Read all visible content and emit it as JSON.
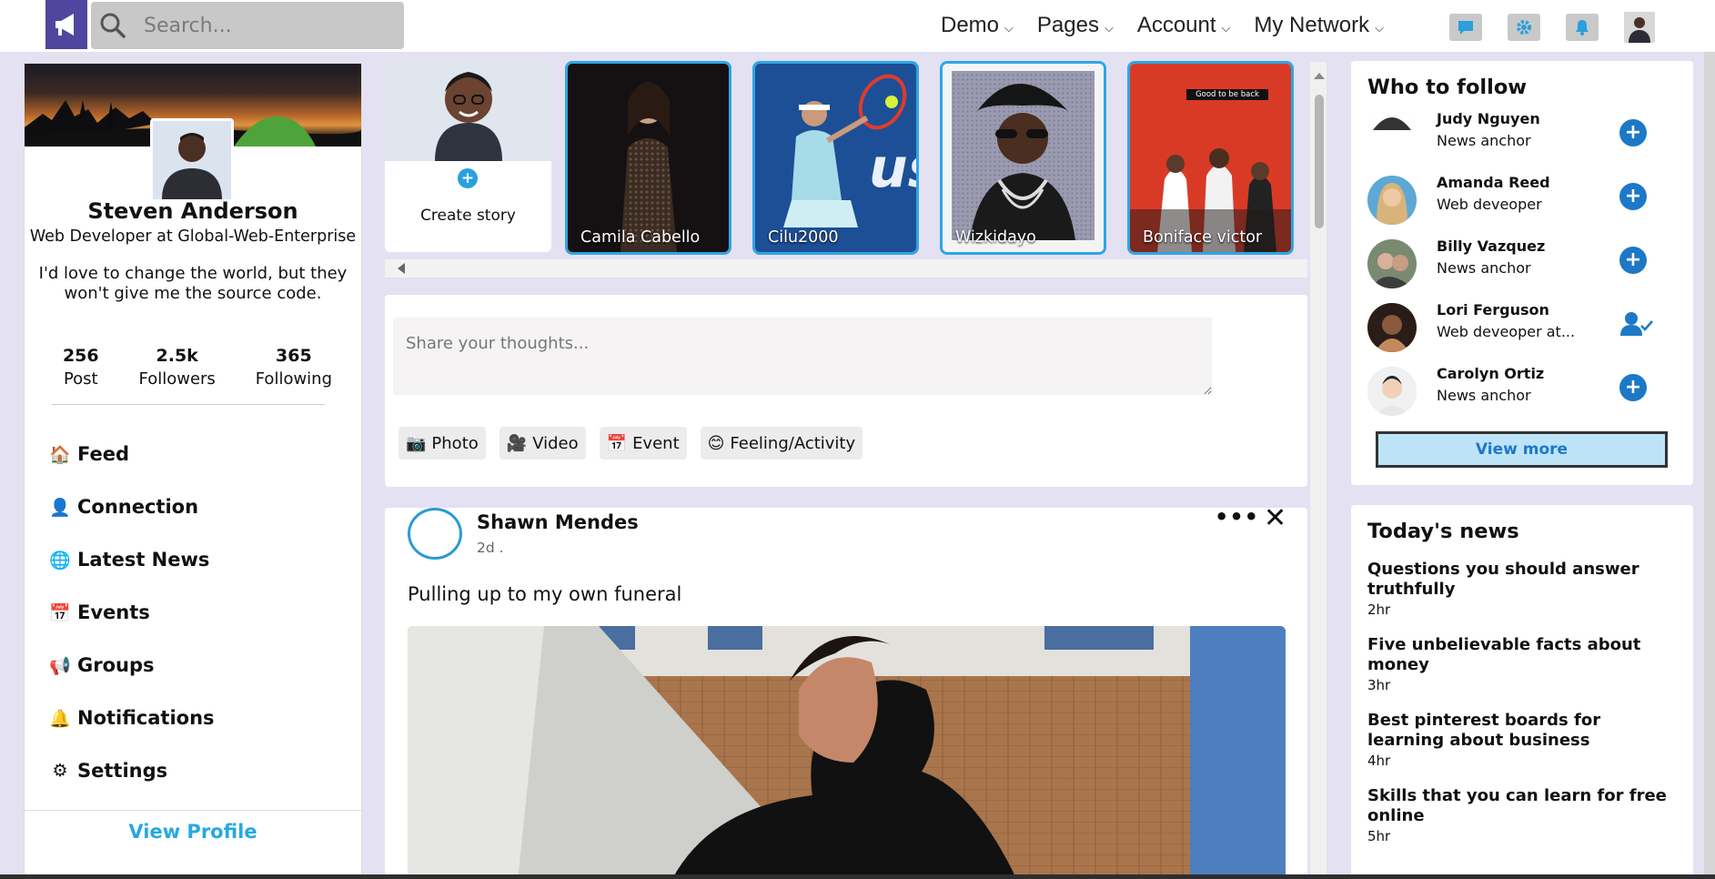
{
  "header": {
    "search_placeholder": "Search...",
    "nav": [
      {
        "label": "Demo"
      },
      {
        "label": "Pages"
      },
      {
        "label": "Account"
      },
      {
        "label": "My Network"
      }
    ],
    "icons": [
      "chat-icon",
      "settings-icon",
      "bell-icon",
      "user-avatar"
    ]
  },
  "profile": {
    "name": "Steven Anderson",
    "title": "Web Developer at Global-Web-Enterprise",
    "bio": "I'd love to change the world, but they won't give me the source code.",
    "stats": [
      {
        "value": "256",
        "label": "Post"
      },
      {
        "value": "2.5k",
        "label": "Followers"
      },
      {
        "value": "365",
        "label": "Following"
      }
    ],
    "menu": [
      {
        "icon": "🏠",
        "label": "Feed"
      },
      {
        "icon": "👤",
        "label": "Connection"
      },
      {
        "icon": "🌐",
        "label": "Latest News"
      },
      {
        "icon": "📅",
        "label": "Events"
      },
      {
        "icon": "📢",
        "label": "Groups"
      },
      {
        "icon": "🔔",
        "label": "Notifications"
      },
      {
        "icon": "⚙",
        "label": "Settings"
      }
    ],
    "view_profile": "View Profile"
  },
  "stories": {
    "create_label": "Create story",
    "items": [
      {
        "name": "Camila Cabello"
      },
      {
        "name": "Cilu2000"
      },
      {
        "name": "Wizkidayo"
      },
      {
        "name": "Boniface victor",
        "overlay": "Good to be back"
      }
    ]
  },
  "composer": {
    "placeholder": "Share your thoughts...",
    "actions": [
      {
        "icon": "📷",
        "label": "Photo"
      },
      {
        "icon": "🎥",
        "label": "Video"
      },
      {
        "icon": "📅",
        "label": "Event"
      },
      {
        "icon": "😊",
        "label": "Feeling/Activity"
      }
    ]
  },
  "post": {
    "author": "Shawn Mendes",
    "time": "2d .",
    "text": "Pulling up to my own funeral",
    "more": "•••",
    "close": "✕"
  },
  "who_to_follow": {
    "title": "Who to follow",
    "people": [
      {
        "name": "Judy Nguyen",
        "role": "News anchor",
        "followed": false
      },
      {
        "name": "Amanda Reed",
        "role": "Web deveoper",
        "followed": false
      },
      {
        "name": "Billy Vazquez",
        "role": "News anchor",
        "followed": false
      },
      {
        "name": "Lori Ferguson",
        "role": "Web deveoper at...",
        "followed": true
      },
      {
        "name": "Carolyn Ortiz",
        "role": "News anchor",
        "followed": false
      }
    ],
    "view_more": "View more"
  },
  "news": {
    "title": "Today's news",
    "items": [
      {
        "title": "Questions you should answer truthfully",
        "time": "2hr"
      },
      {
        "title": "Five unbelievable facts about money",
        "time": "3hr"
      },
      {
        "title": "Best pinterest boards for learning about business",
        "time": "4hr"
      },
      {
        "title": "Skills that you can learn for free online",
        "time": "5hr"
      }
    ]
  },
  "colors": {
    "accent": "#2ea6e6",
    "brand": "#5046a0",
    "page_bg": "#e4e1f3",
    "follow_button": "#1d78c6"
  }
}
